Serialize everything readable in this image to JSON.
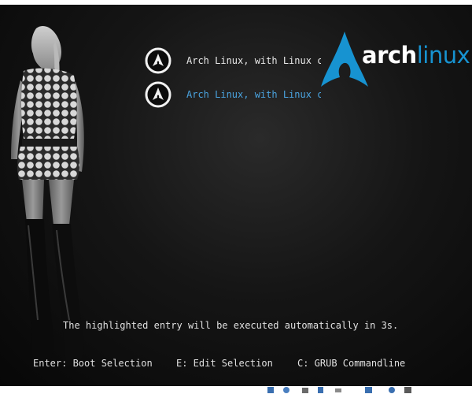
{
  "boot_menu": {
    "entries": [
      {
        "label": "Arch Linux, with Linux core repo kernel",
        "selected": false
      },
      {
        "label": "Arch Linux, with Linux core repo kernel (Fallback initramfs)",
        "selected": true
      }
    ]
  },
  "logo": {
    "word_arch": "arch",
    "word_linux": "linux"
  },
  "countdown_text": "The highlighted entry will be executed automatically in 3s.",
  "hints": {
    "enter": "Enter: Boot Selection",
    "edit": "E: Edit Selection",
    "commandline": "C: GRUB Commandline"
  },
  "colors": {
    "background": "#111111",
    "text": "#e0e0e0",
    "selected_text": "#4aa3df",
    "arch_blue": "#1793d1"
  },
  "icons": [
    "arch-icon",
    "arch-logo-icon",
    "taskbar-tray-icons"
  ]
}
